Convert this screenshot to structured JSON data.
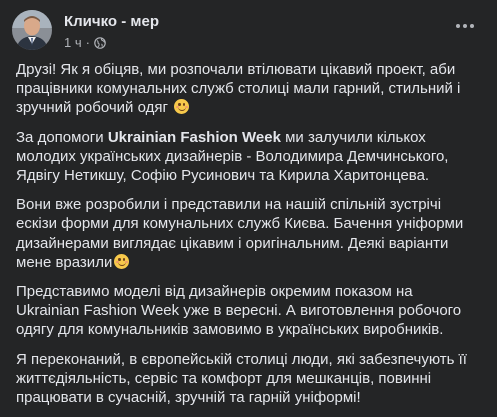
{
  "post": {
    "author": "Кличко - мер",
    "time": "1 ч",
    "separator": "·",
    "icons": {
      "avatar": "avatar-photo",
      "privacy": "globe-icon",
      "more": "more-horizontal-icon",
      "emoji": "smiling-face-icon"
    },
    "paragraphs": {
      "p1": {
        "text": "Друзі! Як я обіцяв, ми розпочали втілювати цікавий проект, аби працівники комунальних служб столиці мали гарний, стильний і зручний робочий одяг"
      },
      "p2": {
        "before": "За допомоги ",
        "brand": "Ukrainian Fashion Week",
        "after": " ми залучили кількох молодих українських дизайнерів - Володимира Демчинського, Ядвігу Нетикшу, Софію Русинович та Кирила Харитонцева."
      },
      "p3": {
        "text": "Вони вже розробили і представили на нашій спільній зустрічі ескізи форми для комунальних служб Києва. Бачення уніформи дизайнерами виглядає цікавим і оригінальним. Деякі варіанти мене вразили"
      },
      "p4": {
        "text": "Представимо моделі від дизайнерів окремим показом на Ukrainian Fashion Week уже в вересні.  А виготовлення робочого одягу для комунальників замовимо в українських виробників."
      },
      "p5": {
        "text": "Я переконаний, в європейській столиці люди, які забезпечують її життєдіяльність, сервіс та комфорт для мешканців, повинні працювати в сучасній, зручній та гарній уніформі!"
      }
    },
    "colors": {
      "background": "#242526",
      "primary_text": "#e4e6eb",
      "secondary_text": "#b0b3b8"
    }
  }
}
